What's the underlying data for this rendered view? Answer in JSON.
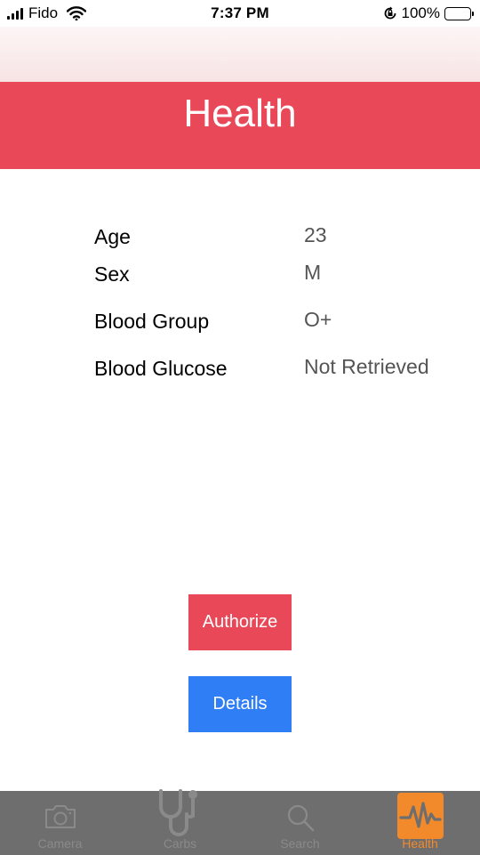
{
  "status_bar": {
    "carrier": "Fido",
    "time": "7:37 PM",
    "battery": "100%"
  },
  "header": {
    "title": "Health"
  },
  "info": [
    {
      "label": "Age",
      "value": "23"
    },
    {
      "label": "Sex",
      "value": "M"
    },
    {
      "label": "Blood Group",
      "value": "O+"
    },
    {
      "label": "Blood Glucose",
      "value": "Not Retrieved"
    }
  ],
  "buttons": {
    "authorize": "Authorize",
    "details": "Details"
  },
  "tab_bar": {
    "tabs": [
      {
        "label": "Camera",
        "icon": "camera-icon"
      },
      {
        "label": "Carbs",
        "icon": "stethoscope-icon"
      },
      {
        "label": "Search",
        "icon": "search-icon"
      },
      {
        "label": "Health",
        "icon": "heartbeat-icon"
      }
    ],
    "active_color": "#f28a2b"
  },
  "colors": {
    "header": "#e84857",
    "authorize": "#e84857",
    "details": "#2f7ef5"
  }
}
